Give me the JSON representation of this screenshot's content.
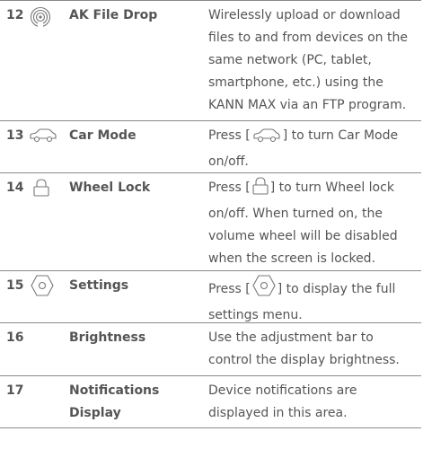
{
  "rows": [
    {
      "number": "12",
      "icon": "wireless-signal-icon",
      "name": "AK File Drop",
      "description": "Wirelessly upload or download files to and from devices on the same network (PC, tablet, smartphone, etc.) using the KANN MAX via an FTP program."
    },
    {
      "number": "13",
      "icon": "car-icon",
      "name": "Car Mode",
      "desc_before": "Press [",
      "desc_after": "] to turn Car Mode on/off."
    },
    {
      "number": "14",
      "icon": "lock-icon",
      "name": "Wheel Lock",
      "desc_before": "Press [",
      "desc_after": "] to turn Wheel lock on/off. When turned on, the volume wheel will be disabled when the screen is locked."
    },
    {
      "number": "15",
      "icon": "settings-hexagon-icon",
      "name": "Settings",
      "desc_before": "Press [",
      "desc_after": "] to display the full settings menu."
    },
    {
      "number": "16",
      "name": "Brightness",
      "description": "Use the adjustment bar to control the display brightness."
    },
    {
      "number": "17",
      "name": "Notifications Display",
      "description": "Device notifications are displayed in this area."
    }
  ]
}
